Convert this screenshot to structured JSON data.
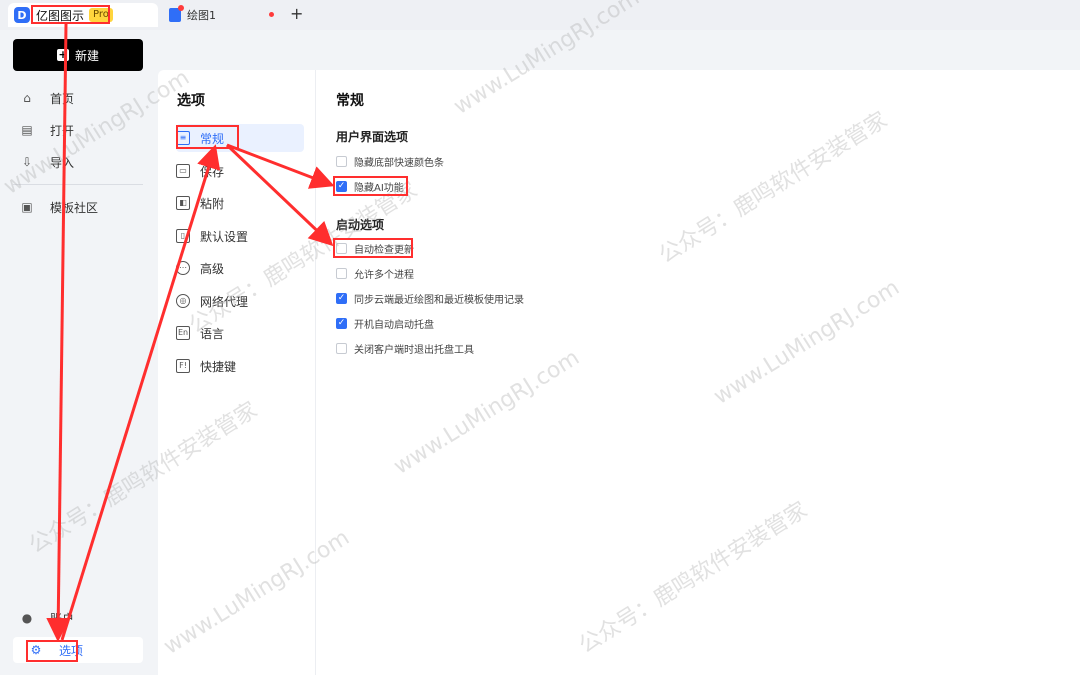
{
  "app": {
    "name": "亿图图示",
    "badge": "Pro",
    "logo_icon": "edraw-logo-icon"
  },
  "tabs": {
    "doc_name": "绘图1",
    "add_label": "+"
  },
  "sidebar": {
    "new_label": "新建",
    "items": [
      {
        "label": "首页",
        "icon": "home-icon"
      },
      {
        "label": "打开",
        "icon": "file-icon"
      },
      {
        "label": "导入",
        "icon": "import-icon"
      },
      {
        "label": "模板社区",
        "icon": "community-icon"
      }
    ],
    "account_label": "账户",
    "options_label": "选项"
  },
  "options": {
    "title": "选项",
    "items": [
      {
        "label": "常规",
        "icon": "general-icon"
      },
      {
        "label": "保存",
        "icon": "save-icon"
      },
      {
        "label": "粘附",
        "icon": "snap-icon"
      },
      {
        "label": "默认设置",
        "icon": "default-icon"
      },
      {
        "label": "高级",
        "icon": "advanced-icon"
      },
      {
        "label": "网络代理",
        "icon": "network-icon"
      },
      {
        "label": "语言",
        "icon": "language-icon"
      },
      {
        "label": "快捷键",
        "icon": "shortcut-icon"
      }
    ]
  },
  "general": {
    "title": "常规",
    "ui_section": "用户界面选项",
    "ui_options": [
      {
        "label": "隐藏底部快速颜色条",
        "checked": false
      },
      {
        "label": "隐藏AI功能",
        "checked": true
      }
    ],
    "startup_section": "启动选项",
    "startup_options": [
      {
        "label": "自动检查更新",
        "checked": false
      },
      {
        "label": "允许多个进程",
        "checked": false
      },
      {
        "label": "同步云端最近绘图和最近模板使用记录",
        "checked": true
      },
      {
        "label": "开机自动启动托盘",
        "checked": true
      },
      {
        "label": "关闭客户端时退出托盘工具",
        "checked": false
      }
    ]
  },
  "watermark": {
    "text_a": "www.LuMingRJ.com",
    "text_b": "公众号：鹿鸣软件安装管家"
  },
  "colors": {
    "accent": "#2f6ef7",
    "annotation": "#ff2e2e",
    "pro_badge": "#ffd53d"
  }
}
